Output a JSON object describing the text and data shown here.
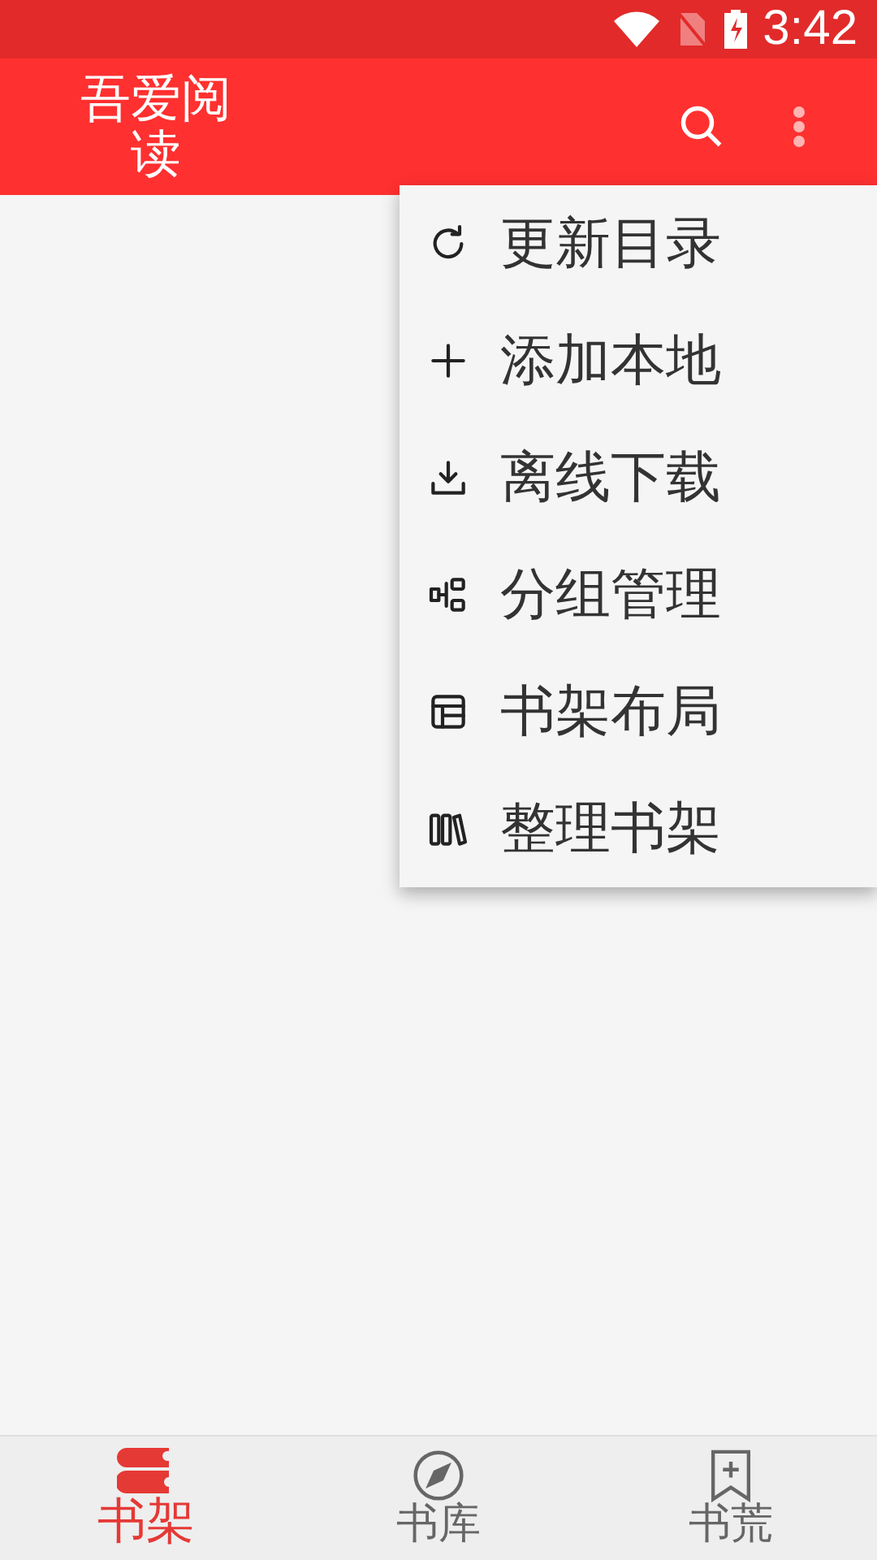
{
  "status_bar": {
    "time": "3:42"
  },
  "app_bar": {
    "title": "吾爱阅读"
  },
  "menu": [
    {
      "kind": "refresh",
      "label": "更新目录"
    },
    {
      "kind": "add",
      "label": "添加本地"
    },
    {
      "kind": "download",
      "label": "离线下载"
    },
    {
      "kind": "group",
      "label": "分组管理"
    },
    {
      "kind": "layout",
      "label": "书架布局"
    },
    {
      "kind": "arrange",
      "label": "整理书架"
    }
  ],
  "bottom_nav": [
    {
      "kind": "shelf",
      "label": "书架",
      "selected": true
    },
    {
      "kind": "explore",
      "label": "书库",
      "selected": false
    },
    {
      "kind": "bookmark",
      "label": "书荒",
      "selected": false
    }
  ]
}
